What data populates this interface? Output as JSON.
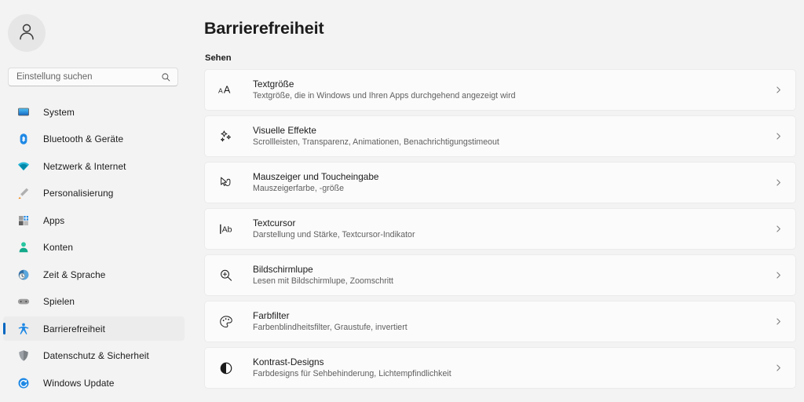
{
  "sidebar": {
    "avatar_icon": "person-avatar-icon",
    "search": {
      "placeholder": "Einstellung suchen",
      "value": "",
      "icon": "search-icon"
    },
    "items": [
      {
        "label": "System",
        "icon": "monitor-icon",
        "selected": false
      },
      {
        "label": "Bluetooth & Geräte",
        "icon": "bluetooth-icon",
        "selected": false
      },
      {
        "label": "Netzwerk & Internet",
        "icon": "wifi-icon",
        "selected": false
      },
      {
        "label": "Personalisierung",
        "icon": "paintbrush-icon",
        "selected": false
      },
      {
        "label": "Apps",
        "icon": "apps-grid-icon",
        "selected": false
      },
      {
        "label": "Konten",
        "icon": "account-person-icon",
        "selected": false
      },
      {
        "label": "Zeit & Sprache",
        "icon": "clock-globe-icon",
        "selected": false
      },
      {
        "label": "Spielen",
        "icon": "gamepad-icon",
        "selected": false
      },
      {
        "label": "Barrierefreiheit",
        "icon": "accessibility-person-icon",
        "selected": true
      },
      {
        "label": "Datenschutz & Sicherheit",
        "icon": "shield-icon",
        "selected": false
      },
      {
        "label": "Windows Update",
        "icon": "refresh-circle-icon",
        "selected": false
      }
    ]
  },
  "main": {
    "title": "Barrierefreiheit",
    "section_label": "Sehen",
    "cards": [
      {
        "title": "Textgröße",
        "subtitle": "Textgröße, die in Windows und Ihren Apps durchgehend angezeigt wird",
        "icon": "text-size-aa-icon",
        "chevron": "chevron-right-icon"
      },
      {
        "title": "Visuelle Effekte",
        "subtitle": "Scrollleisten, Transparenz, Animationen, Benachrichtigungstimeout",
        "icon": "sparkle-effects-icon",
        "chevron": "chevron-right-icon"
      },
      {
        "title": "Mauszeiger und Toucheingabe",
        "subtitle": "Mauszeigerfarbe, -größe",
        "icon": "mouse-pointer-icon",
        "chevron": "chevron-right-icon"
      },
      {
        "title": "Textcursor",
        "subtitle": "Darstellung und Stärke, Textcursor-Indikator",
        "icon": "text-cursor-ab-icon",
        "chevron": "chevron-right-icon"
      },
      {
        "title": "Bildschirmlupe",
        "subtitle": "Lesen mit Bildschirmlupe, Zoomschritt",
        "icon": "magnifier-plus-icon",
        "chevron": "chevron-right-icon"
      },
      {
        "title": "Farbfilter",
        "subtitle": "Farbenblindheitsfilter, Graustufe, invertiert",
        "icon": "color-palette-icon",
        "chevron": "chevron-right-icon"
      },
      {
        "title": "Kontrast-Designs",
        "subtitle": "Farbdesigns für Sehbehinderung, Lichtempfindlichkeit",
        "icon": "contrast-half-circle-icon",
        "chevron": "chevron-right-icon"
      }
    ]
  },
  "colors": {
    "page_background": "#f3f3f3",
    "card_background": "#fbfbfb",
    "accent": "#0067c0",
    "selected_row": "#ececec",
    "text_primary": "#1b1b1b",
    "text_secondary": "#5f5f5f"
  }
}
